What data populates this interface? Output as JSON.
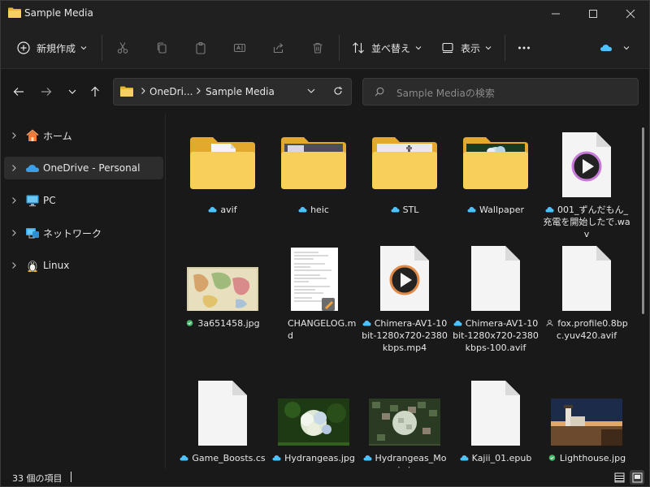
{
  "window": {
    "title": "Sample Media",
    "accent": "#4cc2ff"
  },
  "commandbar": {
    "new_label": "新規作成",
    "sort_label": "並べ替え",
    "view_label": "表示",
    "icons": [
      "cut-icon",
      "copy-icon",
      "paste-icon",
      "rename-icon",
      "share-icon",
      "delete-icon"
    ]
  },
  "address": {
    "crumbs": [
      "OneDri...",
      "Sample Media"
    ],
    "search_placeholder": "Sample Mediaの検索"
  },
  "sidebar": {
    "items": [
      {
        "label": "ホーム",
        "icon": "home-icon"
      },
      {
        "label": "OneDrive - Personal",
        "icon": "cloud-icon",
        "selected": true
      },
      {
        "label": "PC",
        "icon": "pc-icon"
      },
      {
        "label": "ネットワーク",
        "icon": "network-icon"
      },
      {
        "label": "Linux",
        "icon": "linux-icon"
      }
    ]
  },
  "files": [
    {
      "name": "avif",
      "kind": "folder",
      "status": "cloud"
    },
    {
      "name": "heic",
      "kind": "folder",
      "status": "cloud"
    },
    {
      "name": "STL",
      "kind": "folder",
      "status": "cloud"
    },
    {
      "name": "Wallpaper",
      "kind": "folder",
      "status": "cloud"
    },
    {
      "name": "001_ずんだもん_充電を開始したで.wav",
      "kind": "media",
      "status": "cloud"
    },
    {
      "name": "3a651458.jpg",
      "kind": "map-image",
      "status": "synced"
    },
    {
      "name": "CHANGELOG.md",
      "kind": "text-doc",
      "status": "none"
    },
    {
      "name": "Chimera-AV1-10bit-1280x720-2380kbps.mp4",
      "kind": "media",
      "status": "cloud"
    },
    {
      "name": "Chimera-AV1-10bit-1280x720-2380kbps-100.avif",
      "kind": "blank",
      "status": "cloud"
    },
    {
      "name": "fox.profile0.8bpc.yuv420.avif",
      "kind": "blank",
      "status": "shared"
    },
    {
      "name": "Game_Boosts.csv",
      "kind": "blank",
      "status": "cloud"
    },
    {
      "name": "Hydrangeas.jpg",
      "kind": "flower-image",
      "status": "cloud"
    },
    {
      "name": "Hydrangeas_Mosaic.jpg",
      "kind": "mosaic-image",
      "status": "cloud"
    },
    {
      "name": "Kajii_01.epub",
      "kind": "blank",
      "status": "cloud"
    },
    {
      "name": "Lighthouse.jpg",
      "kind": "lighthouse-image",
      "status": "synced"
    }
  ],
  "status": {
    "count": "33 個の項目"
  }
}
